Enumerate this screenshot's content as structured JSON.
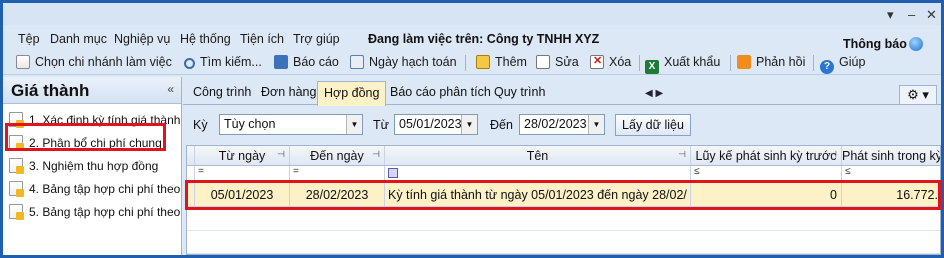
{
  "menu": [
    "Tệp",
    "Danh mục",
    "Nghiệp vụ",
    "Hệ thống",
    "Tiện ích",
    "Trợ giúp"
  ],
  "workspace_label": "Đang làm việc trên: Công ty TNHH XYZ",
  "notify": "Thông báo",
  "window_controls": [
    "▾",
    "–",
    "✕"
  ],
  "toolbar": {
    "branch": "Chọn chi nhánh làm việc",
    "search": "Tìm kiếm...",
    "report": "Báo cáo",
    "accounting_date": "Ngày hạch toán",
    "add": "Thêm",
    "edit": "Sửa",
    "delete": "Xóa",
    "export": "Xuất khẩu",
    "feedback": "Phản hồi",
    "help": "Giúp"
  },
  "left_panel": {
    "title": "Giá thành",
    "collapse": "«",
    "items": [
      "1. Xác định kỳ tính giá thành",
      "2. Phân bổ chi phí chung",
      "3. Nghiệm thu hợp đồng",
      "4. Bảng tập hợp chi phí theo...",
      "5. Bảng tập hợp chi phí theo..."
    ]
  },
  "tabs": [
    "Công trình",
    "Đơn hàng",
    "Hợp đồng",
    "Báo cáo phân tích",
    "Quy trình"
  ],
  "active_tab": "Hợp đồng",
  "tab_nav": "◀ ▶",
  "settings_icon": "⚙ ▾",
  "filter": {
    "period_label": "Kỳ",
    "period_value": "Tùy chọn",
    "from_label": "Từ",
    "from_value": "05/01/2023",
    "to_label": "Đến",
    "to_value": "28/02/2023",
    "fetch_button": "Lấy dữ liệu"
  },
  "grid": {
    "columns": [
      "Từ ngày",
      "Đến ngày",
      "Tên",
      "Lũy kế phát sinh kỳ trước",
      "Phát sinh trong kỳ"
    ],
    "filter_ops": [
      "=",
      "=",
      "",
      "≤",
      "≤"
    ],
    "rows": [
      {
        "from": "05/01/2023",
        "to": "28/02/2023",
        "name": "Kỳ tính giá thành từ ngày 05/01/2023 đến ngày 28/02/",
        "prior": "0",
        "current": "16.772."
      }
    ]
  },
  "colors": {
    "accent": "#1f5fb0",
    "highlight_row": "#fdf1c8",
    "red_box": "#e0141e"
  }
}
